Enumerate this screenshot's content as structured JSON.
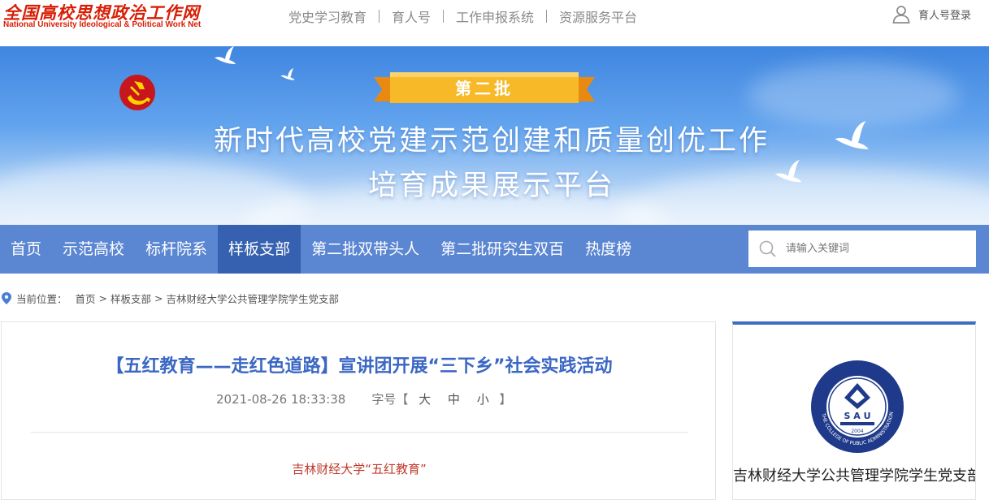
{
  "site": {
    "logo_cn": "全国高校思想政治工作网",
    "logo_en": "National University Ideological & Political Work Net"
  },
  "topnav": {
    "items": [
      "党史学习教育",
      "育人号",
      "工作申报系统",
      "资源服务平台"
    ],
    "login_label": "育人号登录",
    "login_icon": "user-icon"
  },
  "banner": {
    "ribbon": "第二批",
    "title_line1": "新时代高校党建示范创建和质量创优工作",
    "title_line2": "培育成果展示平台"
  },
  "mainnav": {
    "tabs": [
      "首页",
      "示范高校",
      "标杆院系",
      "样板支部",
      "第二批双带头人",
      "第二批研究生双百",
      "热度榜"
    ],
    "active_tab": "样板支部",
    "search_placeholder": "请输入关键词"
  },
  "breadcrumb": {
    "prefix": "当前位置：",
    "items": [
      "首页",
      "样板支部",
      "吉林财经大学公共管理学院学生党支部"
    ],
    "separator": ">"
  },
  "article": {
    "title": "【五红教育——走红色道路】宣讲团开展“三下乡”社会实践活动",
    "datetime": "2021-08-26 18:33:38",
    "font_size_label": "字号【",
    "font_sizes": [
      "大",
      "中",
      "小"
    ],
    "font_size_close": "】",
    "first_line": "吉林财经大学“五红教育”"
  },
  "sidebar": {
    "seal_text_bottom": "THE COLLEGE OF PUBLIC ADMINISTRATION",
    "seal_letters": "S A U",
    "seal_year": "2004",
    "branch_name": "吉林财经大学公共管理学院学生党支部"
  },
  "colors": {
    "brand_red": "#d81e06",
    "nav_blue": "#5b86d2",
    "nav_active": "#3561b0",
    "title_blue": "#3b67c4"
  }
}
